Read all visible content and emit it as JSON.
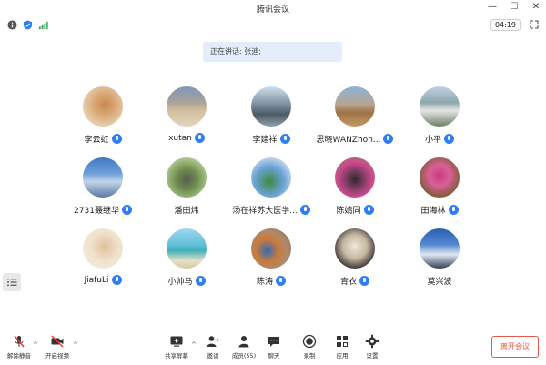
{
  "window": {
    "title": "腾讯会议"
  },
  "status": {
    "timer": "04:19"
  },
  "speaking": {
    "text": "正在讲话: 张迪;"
  },
  "participants": [
    {
      "name": "李云虹"
    },
    {
      "name": "xutan"
    },
    {
      "name": "李建祥"
    },
    {
      "name": "思晓WANZhon..."
    },
    {
      "name": "小平"
    },
    {
      "name": "2731聂继华"
    },
    {
      "name": "潘田炜"
    },
    {
      "name": "汤在祥苏大医学..."
    },
    {
      "name": "陈婧同"
    },
    {
      "name": "田海林"
    },
    {
      "name": "JiafuLi"
    },
    {
      "name": "小帅马"
    },
    {
      "name": "陈涛"
    },
    {
      "name": "青衣"
    },
    {
      "name": "莫兴波"
    }
  ],
  "toolbar": {
    "mute_label": "解除静音",
    "video_label": "开启视频",
    "share_label": "共享屏幕",
    "invite_label": "邀请",
    "members_label": "成员(55)",
    "chat_label": "聊天",
    "record_label": "录制",
    "apps_label": "应用",
    "settings_label": "设置",
    "leave_label": "离开会议"
  },
  "colors": {
    "accent": "#2f7ff2",
    "leave": "#e15b4b",
    "speaking_bg": "#e4eefb"
  }
}
